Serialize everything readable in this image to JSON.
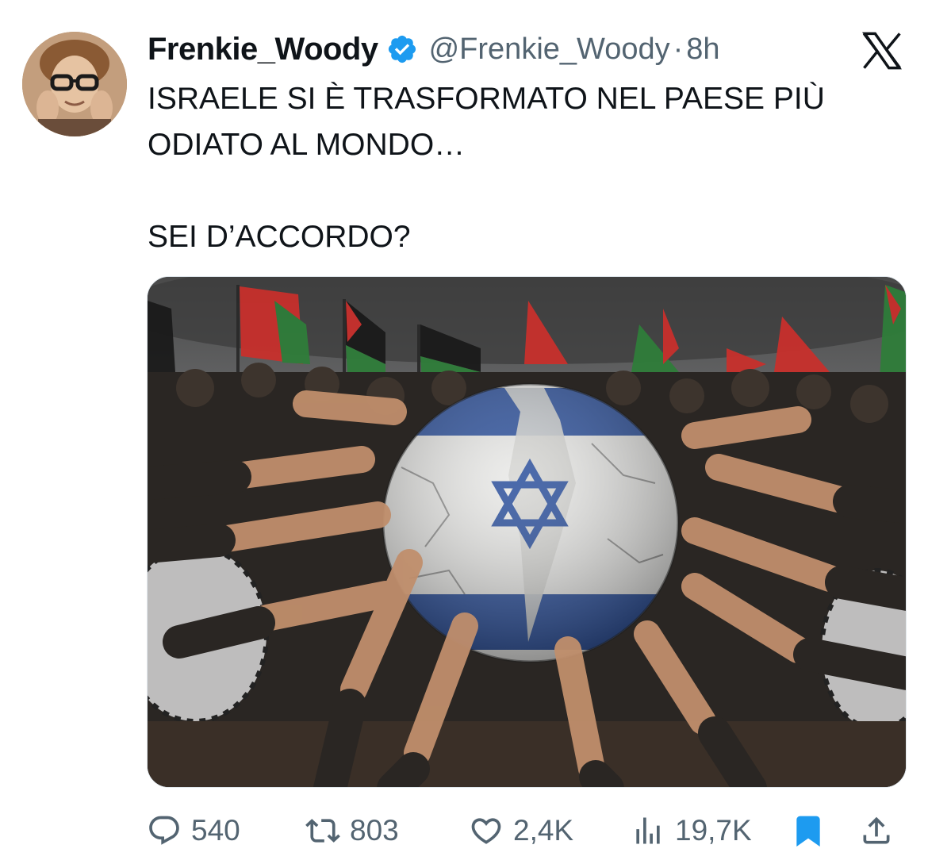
{
  "author": {
    "display_name": "Frenkie_Woody",
    "handle": "@Frenkie_Woody",
    "separator": "·",
    "time": "8h",
    "verified": true
  },
  "platform_icon": "x-logo-icon",
  "text": {
    "line1": "ISRAELE SI È TRASFORMATO NEL PAESE PIÙ",
    "line2": "ODIATO AL MONDO…",
    "line3": "SEI D’ACCORDO?"
  },
  "media": {
    "icon": "photo-image"
  },
  "actions": {
    "replies": "540",
    "retweets": "803",
    "likes": "2,4K",
    "views": "19,7K"
  },
  "colors": {
    "text": "#0f1419",
    "secondary": "#536471",
    "verified": "#1d9bf0",
    "bookmark": "#1d9bf0",
    "israel_blue": "#2a4f9c"
  }
}
